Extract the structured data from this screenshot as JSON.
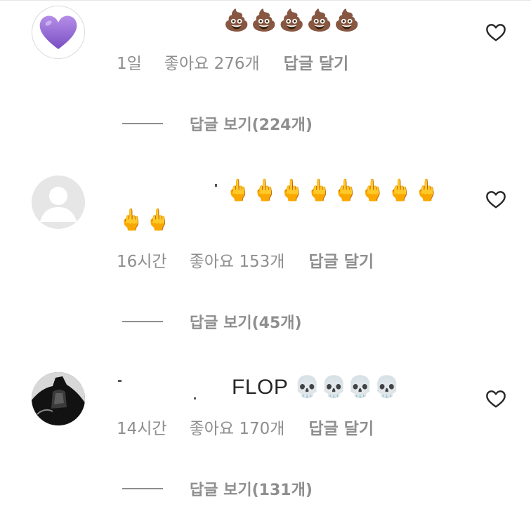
{
  "comments": [
    {
      "text": "💩💩💩💩💩",
      "time": "1일",
      "likes": "좋아요 276개",
      "reply_label": "답글 달기",
      "view_replies": "답글 보기(224개)",
      "avatar_icon": "purple-heart-icon"
    },
    {
      "text_line1": "🖕🖕🖕🖕🖕🖕🖕🖕",
      "text_line2": "🖕🖕",
      "time": "16시간",
      "likes": "좋아요 153개",
      "reply_label": "답글 달기",
      "view_replies": "답글 보기(45개)",
      "avatar_icon": "default-avatar-icon"
    },
    {
      "text": "FLOP 💀💀💀💀",
      "time": "14시간",
      "likes": "좋아요 170개",
      "reply_label": "답글 달기",
      "view_replies": "답글 보기(131개)",
      "avatar_icon": "profile-photo"
    }
  ],
  "colors": {
    "meta_text": "#8e8e8e",
    "body_text": "#262626",
    "heart_stroke": "#262626"
  }
}
